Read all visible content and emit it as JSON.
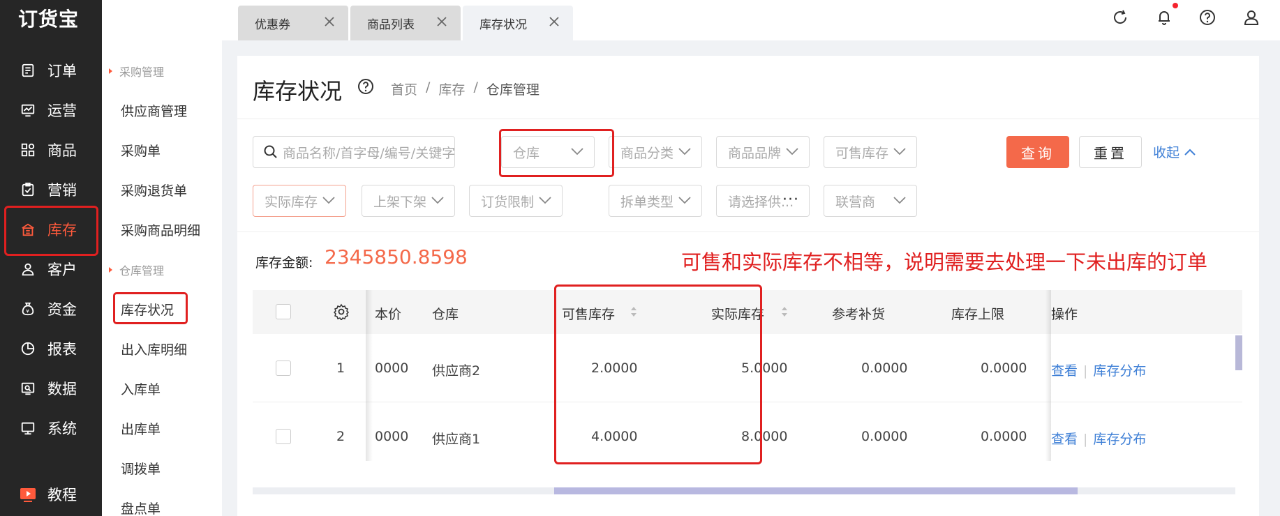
{
  "logo": "订货宝",
  "sidebar": {
    "items": [
      {
        "label": "订单",
        "icon": "order-icon"
      },
      {
        "label": "运营",
        "icon": "operation-icon"
      },
      {
        "label": "商品",
        "icon": "goods-icon"
      },
      {
        "label": "营销",
        "icon": "marketing-icon"
      },
      {
        "label": "库存",
        "icon": "warehouse-icon",
        "active": true
      },
      {
        "label": "客户",
        "icon": "user-icon"
      },
      {
        "label": "资金",
        "icon": "money-bag-icon"
      },
      {
        "label": "报表",
        "icon": "pie-chart-icon"
      },
      {
        "label": "数据",
        "icon": "data-icon"
      },
      {
        "label": "系统",
        "icon": "monitor-icon"
      }
    ],
    "tutorial": {
      "label": "教程",
      "icon": "play-icon"
    }
  },
  "subnav": {
    "group1": "采购管理",
    "group1_items": [
      "供应商管理",
      "采购单",
      "采购退货单",
      "采购商品明细"
    ],
    "group2": "仓库管理",
    "group2_items": [
      "库存状况",
      "出入库明细",
      "入库单",
      "出库单",
      "调拨单",
      "盘点单"
    ]
  },
  "tabs": [
    {
      "label": "优惠券"
    },
    {
      "label": "商品列表"
    },
    {
      "label": "库存状况",
      "active": true
    }
  ],
  "page": {
    "title": "库存状况",
    "breadcrumb": [
      "首页",
      "/",
      "库存",
      "/",
      "仓库管理"
    ]
  },
  "filters": {
    "search_placeholder": "商品名称/首字母/编号/关键字/条",
    "row1": [
      "仓库",
      "商品分类",
      "商品品牌",
      "可售库存"
    ],
    "row2": [
      "实际库存",
      "上架下架",
      "订货限制",
      "拆单类型",
      "请选择供...",
      "联营商"
    ],
    "query": "查询",
    "reset": "重置",
    "collapse": "收起"
  },
  "summary": {
    "label": "库存金额:",
    "value": "2345850.8598"
  },
  "annotation": "可售和实际库存不相等，说明需要去处理一下未出库的订单",
  "table": {
    "headers": {
      "cost": "本价",
      "warehouse": "仓库",
      "available": "可售库存",
      "actual": "实际库存",
      "ref_restock": "参考补货",
      "upper_limit": "库存上限",
      "ops": "操作"
    },
    "rows": [
      {
        "no": "1",
        "cost": "0000",
        "warehouse": "供应商2",
        "available": "2.0000",
        "actual": "5.0000",
        "ref_restock": "0.0000",
        "upper_limit": "0.0000",
        "view": "查看",
        "dist": "库存分布"
      },
      {
        "no": "2",
        "cost": "0000",
        "warehouse": "供应商1",
        "available": "4.0000",
        "actual": "8.0000",
        "ref_restock": "0.0000",
        "upper_limit": "0.0000",
        "view": "查看",
        "dist": "库存分布"
      }
    ]
  },
  "colors": {
    "accent": "#f4694a",
    "link": "#3e7fd6",
    "annotation_red": "#e02020",
    "sidebar_bg": "#262626"
  }
}
